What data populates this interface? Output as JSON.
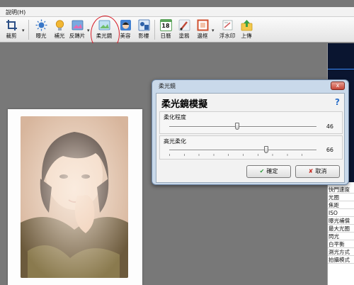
{
  "menubar": {
    "help_label": "說明(H)"
  },
  "toolbar": {
    "items": [
      {
        "label": "裁剪",
        "icon": "crop-icon",
        "color": "#2c4f86"
      },
      {
        "label": "曝光",
        "icon": "sun-icon",
        "color": "#3a78c8"
      },
      {
        "label": "補光",
        "icon": "lightbulb-icon",
        "color": "#f2b733"
      },
      {
        "label": "反轉片",
        "icon": "film-icon",
        "color": "#7aa9e0"
      },
      {
        "label": "柔光鏡",
        "icon": "soft-focus-icon",
        "color": "#5ba3d6"
      },
      {
        "label": "美容",
        "icon": "face-icon",
        "color": "#3f7fd1"
      },
      {
        "label": "影樓",
        "icon": "studio-icon",
        "color": "#2e62a8"
      },
      {
        "label": "日曆",
        "icon": "calendar-icon",
        "color": "#5aa35a"
      },
      {
        "label": "塗鴉",
        "icon": "brush-icon",
        "color": "#c04a3a"
      },
      {
        "label": "邊框",
        "icon": "frame-icon",
        "color": "#d0502f"
      },
      {
        "label": "浮水印",
        "icon": "watermark-icon",
        "color": "#d06060"
      },
      {
        "label": "上傳",
        "icon": "upload-icon",
        "color": "#e0a020"
      }
    ],
    "calendar_number": "18"
  },
  "dialog": {
    "title": "柔光鏡",
    "close_symbol": "x",
    "heading": "柔光鏡模擬",
    "help_symbol": "?",
    "sliders": [
      {
        "label": "柔化程度",
        "value": 46,
        "value_text": "46",
        "min": 0,
        "max": 100
      },
      {
        "label": "高光柔化",
        "value": 66,
        "value_text": "66",
        "min": 0,
        "max": 100
      }
    ],
    "ok_label": "確定",
    "ok_icon": "check-icon",
    "cancel_label": "取消",
    "cancel_icon": "x-icon"
  },
  "properties": {
    "items": [
      "快門速度",
      "光圈",
      "焦距",
      "ISO",
      "曝光補償",
      "最大光圈",
      "閃光",
      "白平衡",
      "測光方式",
      "拍攝模式"
    ]
  },
  "colors": {
    "highlight_ring": "#d81e28",
    "dialog_frame": "#c9d9ea"
  }
}
